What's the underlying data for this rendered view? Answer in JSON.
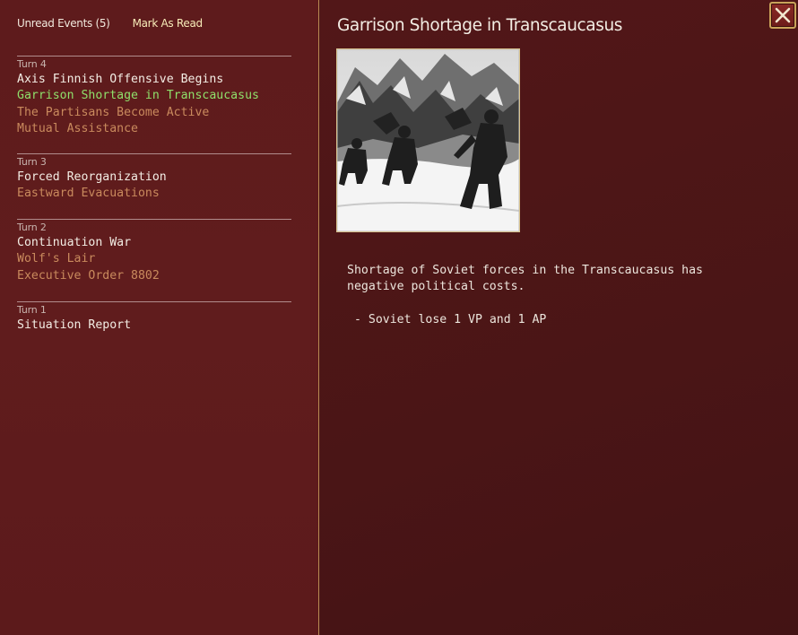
{
  "header": {
    "unread_label": "Unread Events (5)",
    "mark_read_label": "Mark As Read"
  },
  "turns": [
    {
      "label": "Turn 4",
      "events": [
        {
          "title": "Axis Finnish Offensive Begins",
          "state": "unread"
        },
        {
          "title": "Garrison Shortage in Transcaucasus",
          "state": "selected"
        },
        {
          "title": "The Partisans Become Active",
          "state": "read"
        },
        {
          "title": "Mutual Assistance",
          "state": "read"
        }
      ]
    },
    {
      "label": "Turn 3",
      "events": [
        {
          "title": "Forced Reorganization",
          "state": "unread"
        },
        {
          "title": "Eastward Evacuations",
          "state": "read"
        }
      ]
    },
    {
      "label": "Turn 2",
      "events": [
        {
          "title": "Continuation War",
          "state": "unread"
        },
        {
          "title": "Wolf's Lair",
          "state": "read"
        },
        {
          "title": "Executive Order 8802",
          "state": "read"
        }
      ]
    },
    {
      "label": "Turn 1",
      "events": [
        {
          "title": "Situation Report",
          "state": "unread"
        }
      ]
    }
  ],
  "detail": {
    "title": "Garrison Shortage in Transcaucasus",
    "body": "Shortage of Soviet forces in the Transcaucasus has\nnegative political costs.",
    "effect": "- Soviet lose 1 VP and 1 AP",
    "image_subject": "black-and-white photo of soldiers advancing through snow in the mountains"
  },
  "colors": {
    "left_panel_bg": "#5e1b1c",
    "right_panel_bg": "#4e1718",
    "unread_event": "#f3ede4",
    "read_event": "#c98a5d",
    "selected_event": "#8fe06b",
    "accent_gold": "#caa35a"
  },
  "icons": {
    "close": "close-icon"
  }
}
